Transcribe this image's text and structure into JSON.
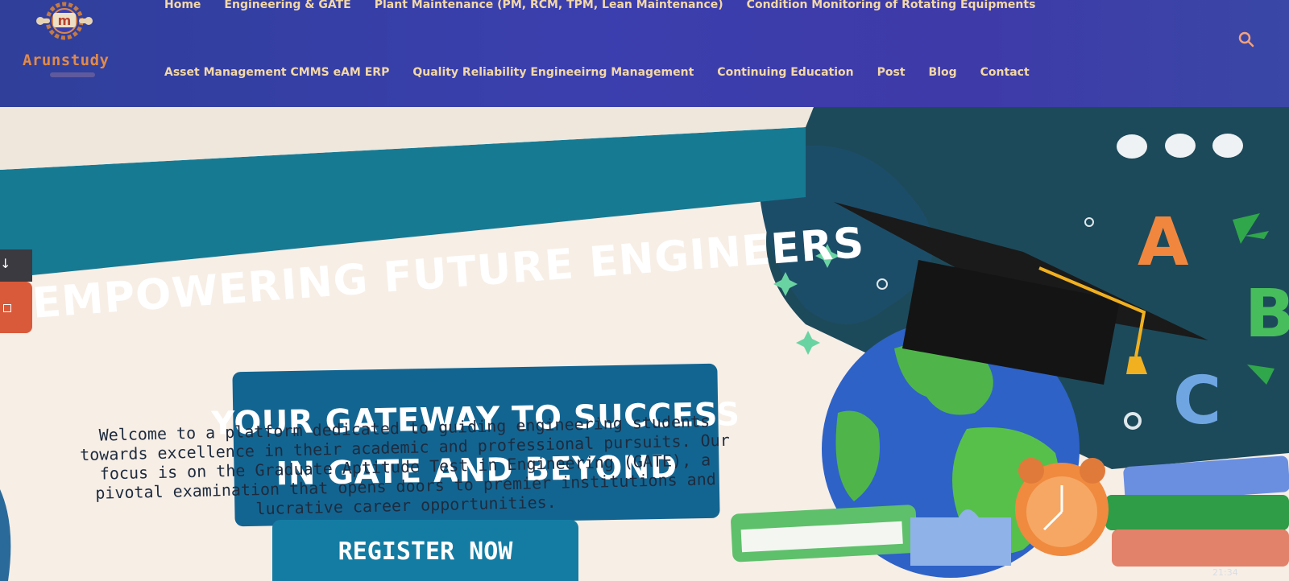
{
  "brand": {
    "name": "Arunstudy",
    "logo_glyph": "m"
  },
  "nav": {
    "row1": [
      "Home",
      "Engineering & GATE",
      "Plant Maintenance (PM, RCM, TPM, Lean Maintenance)",
      "Condition Monitoring of Rotating Equipments"
    ],
    "row2": [
      "Asset Management CMMS eAM ERP",
      "Quality Reliability Engineeirng Management",
      "Continuing Education",
      "Post",
      "Blog",
      "Contact"
    ],
    "search_icon": "search-icon"
  },
  "hero": {
    "headline": "\"EMPOWERING FUTURE ENGINEERS",
    "gateway_line1": "YOUR GATEWAY TO SUCCESS",
    "gateway_line2": "IN GATE AND BEYOND",
    "welcome_lines": [
      "Welcome to a platform dedicated to guiding engineering students",
      "towards excellence in their academic and professional pursuits. Our",
      "focus is on the Graduate Aptitude Test in Engineering (GATE), a",
      "pivotal examination that opens doors to premier institutions and",
      "lucrative career opportunities."
    ],
    "register_label": "REGISTER NOW",
    "illustration_letters": [
      "A",
      "B",
      "C"
    ]
  },
  "side_widgets": {
    "arrow": "↓"
  },
  "taskbar": {
    "time": "21:34"
  },
  "colors": {
    "header_bg": "#3b3fae",
    "nav_text": "#f2d7a8",
    "logo_orange": "#e08a4a",
    "hero_bg": "#f7eee6",
    "teal_banner": "#177a93",
    "gateway_box": "#136591",
    "register_button": "#147ca3",
    "chalkboard": "#1d4a5a"
  }
}
